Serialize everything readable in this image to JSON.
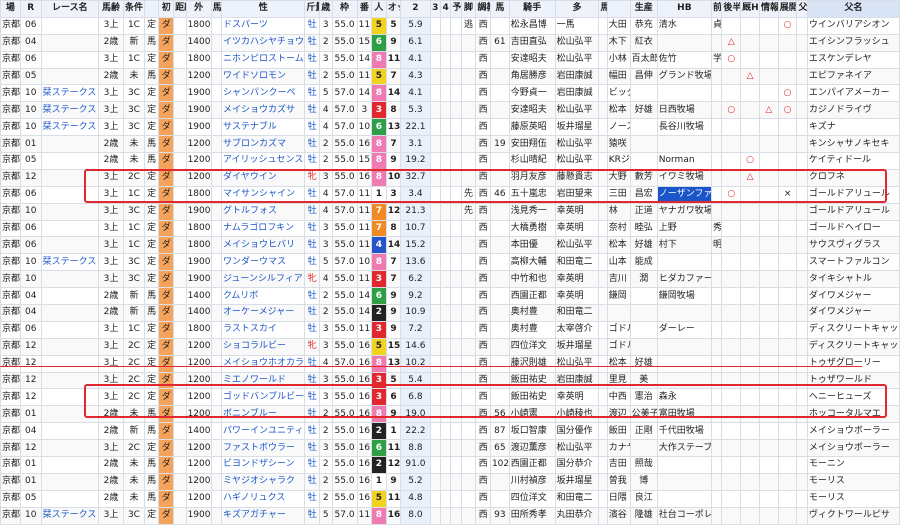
{
  "headers": [
    "場",
    "R",
    "レース名",
    "馬齢",
    "条件",
    "",
    "初",
    "距離",
    "外",
    "馬名",
    "性",
    "斤量",
    "歳",
    "枠",
    "番",
    "人",
    "オッズ",
    "2",
    "3",
    "4",
    "予",
    "脚",
    "調教",
    "馬",
    "騎手",
    "多",
    "馬主",
    "",
    "生産",
    "HB",
    "前半",
    "後半",
    "厩H",
    "情報",
    "展開",
    "父名"
  ],
  "rows": [
    [
      "京都",
      "06",
      "",
      "3上",
      "1C",
      "定",
      "ダ",
      "",
      "1800",
      "",
      "ドスパーツ",
      "牡",
      "3",
      "55.0",
      "11",
      "5",
      "5",
      "5.9",
      "",
      "",
      "",
      "逃",
      "西",
      "",
      "松永昌博",
      "一馬",
      "",
      "大田",
      "恭充",
      "清水",
      "貞信",
      "",
      "",
      "",
      "○",
      "",
      "ウインバリアシオン"
    ],
    [
      "京都",
      "04",
      "",
      "2歳",
      "新",
      "馬",
      "ダ",
      "",
      "1400",
      "",
      "イツカハシヤチョウ",
      "牡",
      "2",
      "55.0",
      "15",
      "6",
      "9",
      "6.1",
      "",
      "",
      "",
      "",
      "西",
      "61",
      "吉田直弘",
      "松山弘平",
      "",
      "木下",
      "紅衣",
      "",
      "",
      "△",
      "",
      "",
      "",
      "",
      "エイシンフラッシュ"
    ],
    [
      "京都",
      "06",
      "",
      "3上",
      "1C",
      "定",
      "ダ",
      "",
      "1800",
      "",
      "ニホンピロストーム",
      "牡",
      "3",
      "55.0",
      "14",
      "8",
      "11",
      "4.1",
      "",
      "",
      "",
      "",
      "西",
      "",
      "安達昭夫",
      "松山弘平",
      "",
      "小林",
      "百太郎",
      "佐竹",
      "学",
      "○",
      "",
      "",
      "",
      "",
      "エスケンデレヤ"
    ],
    [
      "京都",
      "05",
      "",
      "2歳",
      "未",
      "馬",
      "ダ",
      "",
      "1200",
      "",
      "ワイドソロモン",
      "牡",
      "2",
      "55.0",
      "11",
      "5",
      "7",
      "4.3",
      "",
      "",
      "",
      "",
      "西",
      "",
      "角居勝彦",
      "岩田康誠",
      "",
      "幅田",
      "昌伸",
      "グランド牧場",
      "",
      "",
      "△",
      "",
      "",
      "",
      "エピファネイア"
    ],
    [
      "京都",
      "10",
      "栞ステークス",
      "3上",
      "3C",
      "定",
      "ダ",
      "",
      "1900",
      "",
      "シャンパンクーペ",
      "牡",
      "5",
      "57.0",
      "14",
      "8",
      "14",
      "4.1",
      "",
      "",
      "",
      "",
      "西",
      "",
      "今野貞一",
      "岩田康誠",
      "",
      "ビッグレッドファーム",
      "",
      "",
      "",
      "",
      "",
      "",
      "○",
      "",
      "エンパイアメーカー"
    ],
    [
      "京都",
      "10",
      "栞ステークス",
      "3上",
      "3C",
      "定",
      "ダ",
      "",
      "1900",
      "",
      "メイショウカズサ",
      "牡",
      "4",
      "57.0",
      "3",
      "3",
      "8",
      "5.3",
      "",
      "",
      "",
      "",
      "西",
      "",
      "安達昭夫",
      "松山弘平",
      "",
      "松本",
      "好雄",
      "日西牧場",
      "",
      "○",
      "",
      "△",
      "○",
      "",
      "カジノドライヴ"
    ],
    [
      "京都",
      "10",
      "栞ステークス",
      "3上",
      "3C",
      "定",
      "ダ",
      "",
      "1900",
      "",
      "サステナブル",
      "牡",
      "4",
      "57.0",
      "10",
      "6",
      "13",
      "22.1",
      "",
      "",
      "",
      "",
      "西",
      "",
      "藤原英昭",
      "坂井瑠星",
      "",
      "ノースヒルズ",
      "",
      "長谷川牧場",
      "",
      "",
      "",
      "",
      "",
      "",
      "キズナ"
    ],
    [
      "京都",
      "01",
      "",
      "2歳",
      "未",
      "馬",
      "ダ",
      "",
      "1200",
      "",
      "サブロンカズマ",
      "牡",
      "2",
      "55.0",
      "16",
      "8",
      "7",
      "3.1",
      "",
      "",
      "",
      "",
      "西",
      "19",
      "安田翔伍",
      "松山弘平",
      "",
      "猿咲",
      "",
      "",
      " ",
      "",
      "",
      " ",
      "",
      "",
      "キンシャサノキセキ"
    ],
    [
      "京都",
      "05",
      "",
      "2歳",
      "未",
      "馬",
      "ダ",
      "",
      "1200",
      "",
      "アイリッシュセンス",
      "牡",
      "2",
      "55.0",
      "15",
      "8",
      "9",
      "19.2",
      "",
      "",
      "",
      "",
      "西",
      "",
      "杉山晴紀",
      "松山弘平",
      "",
      "KRジャパン",
      "",
      "Norman",
      "",
      "",
      "○",
      "",
      "",
      "",
      "ケイティドール"
    ],
    [
      "京都",
      "12",
      "",
      "3上",
      "2C",
      "定",
      "ダ",
      "",
      "1200",
      "",
      "ダイヤウイン",
      "牝",
      "3",
      "55.0",
      "16",
      "8",
      "10",
      "32.7",
      "",
      "",
      "",
      "",
      "西",
      "",
      "羽月友彦",
      "藤懸貴志",
      "",
      "大野",
      "數芳",
      "イワミ牧場",
      "",
      "",
      "△",
      "",
      "",
      "",
      "クロフネ"
    ],
    [
      "京都",
      "06",
      "",
      "3上",
      "1C",
      "定",
      "ダ",
      "",
      "1800",
      "",
      "マイサンシャイン",
      "牡",
      "4",
      "57.0",
      "11",
      "1",
      "3",
      "3.4",
      "",
      "",
      "",
      "先",
      "西",
      "46",
      "五十嵐忠",
      "岩田望来",
      "",
      "三田",
      "昌宏",
      "ノーザンファーム",
      "",
      "○",
      "",
      "",
      "×",
      "",
      "ゴールドアリュール"
    ],
    [
      "京都",
      "10",
      "",
      "3上",
      "3C",
      "定",
      "ダ",
      "",
      "1900",
      "",
      "グトルフォス",
      "牡",
      "4",
      "57.0",
      "11",
      "7",
      "12",
      "21.3",
      "",
      "",
      "",
      "先",
      "西",
      "",
      "浅見秀一",
      "幸英明",
      "",
      "林",
      "正道",
      "ヤナガワ牧場",
      "",
      "",
      "",
      "",
      "",
      "",
      "ゴールドアリュール"
    ],
    [
      "京都",
      "06",
      "",
      "3上",
      "1C",
      "定",
      "ダ",
      "",
      "1800",
      "",
      "ナムラゴロフキン",
      "牡",
      "3",
      "55.0",
      "11",
      "7",
      "8",
      "10.7",
      "",
      "",
      "",
      "",
      "西",
      "",
      "大橋勇樹",
      "幸英明",
      "",
      "奈村",
      "睦弘",
      "上野",
      "秀樹",
      "",
      "",
      "",
      "",
      "",
      "ゴールドヘイロー"
    ],
    [
      "京都",
      "06",
      "",
      "3上",
      "1C",
      "定",
      "ダ",
      "",
      "1800",
      "",
      "メイショウヒバリ",
      "牡",
      "3",
      "55.0",
      "11",
      "4",
      "14",
      "15.2",
      "",
      "",
      "",
      "",
      "西",
      "",
      "本田優",
      "松山弘平",
      "",
      "松本",
      "好雄",
      "村下",
      "明博",
      "",
      "",
      "",
      "",
      "",
      "サウスヴィグラス"
    ],
    [
      "京都",
      "10",
      "栞ステークス",
      "3上",
      "3C",
      "定",
      "ダ",
      "",
      "1900",
      "",
      "ワンダーウマス",
      "牡",
      "5",
      "57.0",
      "10",
      "8",
      "7",
      "13.6",
      "",
      "",
      "",
      "",
      "西",
      "",
      "高柳大輔",
      "和田竜二",
      "",
      "山本",
      "能成",
      "",
      "",
      "",
      "",
      "",
      "",
      "",
      "スマートファルコン"
    ],
    [
      "京都",
      "10",
      "",
      "3上",
      "3C",
      "定",
      "ダ",
      "",
      "1900",
      "",
      "ジューンシルフィア",
      "牝",
      "4",
      "55.0",
      "11",
      "3",
      "7",
      "6.2",
      "",
      "",
      "",
      "",
      "西",
      "",
      "中竹和也",
      "幸英明",
      "",
      "吉川",
      "潤",
      "ヒダカファーム",
      "",
      "",
      "",
      "",
      "",
      "",
      "タイキシャトル"
    ],
    [
      "京都",
      "04",
      "",
      "2歳",
      "新",
      "馬",
      "ダ",
      "",
      "1400",
      "",
      "クムリボ",
      "牡",
      "2",
      "55.0",
      "14",
      "6",
      "9",
      "9.2",
      "",
      "",
      "",
      "",
      "西",
      "",
      "西園正都",
      "幸英明",
      "",
      "鎌岡",
      "",
      "鎌岡牧場",
      "",
      "",
      "",
      "",
      "",
      "",
      "ダイワメジャー"
    ],
    [
      "京都",
      "04",
      "",
      "2歳",
      "新",
      "馬",
      "ダ",
      "",
      "1400",
      "",
      "オーケーメジャー",
      "牡",
      "2",
      "55.0",
      "14",
      "2",
      "9",
      "10.9",
      "",
      "",
      "",
      "",
      "西",
      "",
      "奥村豊",
      "和田竜二",
      "",
      "",
      "",
      "",
      "",
      "",
      "",
      "",
      "",
      "",
      "ダイワメジャー"
    ],
    [
      "京都",
      "06",
      "",
      "3上",
      "1C",
      "定",
      "ダ",
      "",
      "1800",
      "",
      "ラストスカイ",
      "牡",
      "3",
      "55.0",
      "11",
      "3",
      "9",
      "7.2",
      "",
      "",
      "",
      "",
      "西",
      "",
      "奥村豊",
      "太宰啓介",
      "",
      "ゴドルフィン",
      "",
      "ダーレー",
      "",
      "",
      "",
      "",
      "",
      "",
      "ディスクリートキャット"
    ],
    [
      "京都",
      "12",
      "",
      "3上",
      "2C",
      "定",
      "ダ",
      "",
      "1200",
      "",
      "ショコラルビー",
      "牝",
      "3",
      "55.0",
      "16",
      "5",
      "15",
      "14.6",
      "",
      "",
      "",
      "",
      "西",
      "",
      "四位洋文",
      "坂井瑠星",
      "",
      "ゴドルフィン",
      "",
      "",
      "",
      "",
      "",
      "",
      "",
      "",
      "ディスクリートキャット"
    ],
    [
      "京都",
      "12",
      "",
      "3上",
      "2C",
      "定",
      "ダ",
      "",
      "1200",
      "",
      "メイショウホオカラ",
      "牡",
      "4",
      "57.0",
      "16",
      "8",
      "13",
      "10.2",
      "",
      "",
      "",
      "",
      "西",
      "",
      "藤沢則雄",
      "松山弘平",
      "",
      "松本",
      "好雄",
      "",
      "",
      "",
      "",
      "",
      "",
      "",
      "トゥザグローリー"
    ],
    [
      "京都",
      "12",
      "",
      "3上",
      "2C",
      "定",
      "ダ",
      "",
      "1200",
      "",
      "ミエノワールド",
      "牡",
      "3",
      "55.0",
      "16",
      "3",
      "5",
      "5.4",
      "",
      "",
      "",
      "",
      "西",
      "",
      "飯田祐史",
      "岩田康誠",
      "",
      "里見",
      "美",
      "",
      "",
      "",
      "",
      "",
      "",
      "",
      "トゥザワールド"
    ],
    [
      "京都",
      "12",
      "",
      "3上",
      "2C",
      "定",
      "ダ",
      "",
      "1200",
      "",
      "ゴッドバンブルビー",
      "牡",
      "3",
      "55.0",
      "16",
      "3",
      "6",
      "6.8",
      "",
      "",
      "",
      "",
      "西",
      "",
      "飯田祐史",
      "幸英明",
      "",
      "中西",
      "憲治",
      "森永",
      "",
      "",
      "",
      "",
      "",
      "",
      "ヘニーヒューズ"
    ],
    [
      "京都",
      "01",
      "",
      "2歳",
      "未",
      "馬",
      "ダ",
      "",
      "1200",
      "",
      "ボニンブルー",
      "牡",
      "2",
      "55.0",
      "16",
      "8",
      "9",
      "19.0",
      "",
      "",
      "",
      "",
      "西",
      "56",
      "小崎憲",
      "小崎稜也",
      "",
      "渡辺",
      "公美子",
      "富田牧場",
      "",
      "",
      "",
      "",
      "",
      "",
      "ホッコータルマエ"
    ],
    [
      "京都",
      "04",
      "",
      "2歳",
      "新",
      "馬",
      "ダ",
      "",
      "1400",
      "",
      "パワーインユニティ",
      "牡",
      "2",
      "55.0",
      "16",
      "2",
      "1",
      "22.2",
      "",
      "",
      "",
      "",
      "西",
      "87",
      "坂口智康",
      "国分優作",
      "",
      "飯田",
      "正剛",
      "千代田牧場",
      "",
      "",
      "",
      "",
      "",
      "",
      "メイショウボーラー"
    ],
    [
      "京都",
      "12",
      "",
      "3上",
      "2C",
      "定",
      "ダ",
      "",
      "1200",
      "",
      "ファストボウラー",
      "牡",
      "3",
      "55.0",
      "16",
      "6",
      "11",
      "8.8",
      "",
      "",
      "",
      "",
      "西",
      "65",
      "渡辺薫彦",
      "松山弘平",
      "",
      "カナヤマホールディングス",
      "",
      "大作ステーブル",
      "",
      "",
      "",
      "",
      "",
      "",
      "メイショウボーラー"
    ],
    [
      "京都",
      "01",
      "",
      "2歳",
      "未",
      "馬",
      "ダ",
      "",
      "1200",
      "",
      "ビヨンドザシーン",
      "牡",
      "2",
      "55.0",
      "16",
      "2",
      "12",
      "91.0",
      "",
      "",
      "",
      "",
      "西",
      "102",
      "西園正都",
      "国分恭介",
      "",
      "吉田",
      "照哉",
      "",
      "",
      "",
      "",
      "",
      "",
      "",
      "モーニン"
    ],
    [
      "京都",
      "01",
      "",
      "2歳",
      "未",
      "馬",
      "ダ",
      "",
      "1200",
      "",
      "ミヤジオシャラク",
      "牡",
      "2",
      "55.0",
      "16",
      "1",
      "9",
      "5.2",
      "",
      "",
      "",
      "",
      "西",
      "",
      "川村禎彦",
      "坂井瑠星",
      "",
      "曽我",
      "博",
      "",
      "",
      "",
      "",
      "",
      "",
      "",
      "モーリス"
    ],
    [
      "京都",
      "05",
      "",
      "2歳",
      "未",
      "馬",
      "ダ",
      "",
      "1200",
      "",
      "ハギノリュクス",
      "牡",
      "2",
      "55.0",
      "16",
      "5",
      "11",
      "4.8",
      "",
      "",
      "",
      "",
      "西",
      "",
      "四位洋文",
      "和田竜二",
      "",
      "日隈",
      "良江",
      "",
      "",
      "",
      "",
      "",
      "",
      "",
      "モーリス"
    ],
    [
      "京都",
      "10",
      "栞ステークス",
      "3上",
      "3C",
      "定",
      "ダ",
      "",
      "1900",
      "",
      "キズアガチャー",
      "牡",
      "5",
      "57.0",
      "11",
      "8",
      "16",
      "8.0",
      "",
      "",
      "",
      "",
      "西",
      "93",
      "田所秀孝",
      "丸田恭介",
      "",
      "濱谷",
      "隆雄",
      "社台コーポレーション",
      "",
      "",
      "",
      "",
      "",
      "",
      "ヴィクトワールピサ"
    ]
  ]
}
